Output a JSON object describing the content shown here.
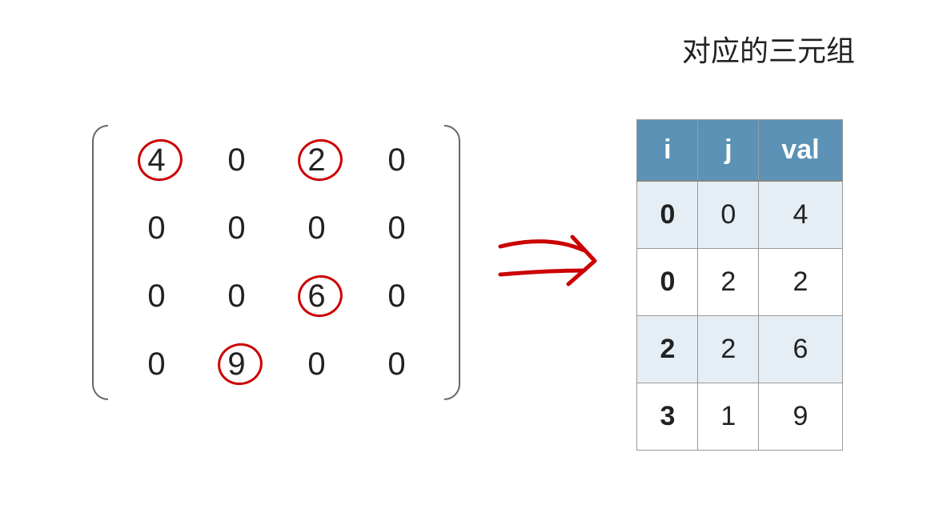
{
  "title": "对应的三元组",
  "matrix": {
    "rows": [
      [
        "4",
        "0",
        "2",
        "0"
      ],
      [
        "0",
        "0",
        "0",
        "0"
      ],
      [
        "0",
        "0",
        "6",
        "0"
      ],
      [
        "0",
        "9",
        "0",
        "0"
      ]
    ],
    "circled": [
      {
        "r": 0,
        "c": 0
      },
      {
        "r": 0,
        "c": 2
      },
      {
        "r": 2,
        "c": 2
      },
      {
        "r": 3,
        "c": 1
      }
    ]
  },
  "table_headers": [
    "i",
    "j",
    "val"
  ],
  "triples": [
    {
      "i": "0",
      "j": "0",
      "val": "4"
    },
    {
      "i": "0",
      "j": "2",
      "val": "2"
    },
    {
      "i": "2",
      "j": "2",
      "val": "6"
    },
    {
      "i": "3",
      "j": "1",
      "val": "9"
    }
  ],
  "colors": {
    "header_bg": "#5b92b5",
    "alt_row_bg": "#e6eef5",
    "circle": "#cc0000"
  }
}
